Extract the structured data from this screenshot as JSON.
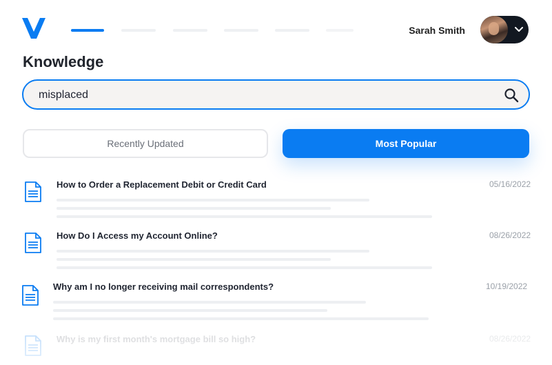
{
  "header": {
    "logo_label": "V",
    "user_name": "Sarah Smith",
    "avatar_icon": "user-avatar",
    "menu_icon": "chevron-down-icon",
    "nav_items": [
      {
        "label": "",
        "active": true
      },
      {
        "label": "",
        "active": false
      },
      {
        "label": "",
        "active": false
      },
      {
        "label": "",
        "active": false
      },
      {
        "label": "",
        "active": false
      },
      {
        "label": "",
        "active": false
      }
    ]
  },
  "page": {
    "title": "Knowledge"
  },
  "search": {
    "value": "misplaced",
    "placeholder": "",
    "icon": "search-icon"
  },
  "tabs": {
    "recent_label": "Recently Updated",
    "popular_label": "Most Popular",
    "selected": "Most Popular"
  },
  "articles": [
    {
      "title": "How to Order a Replacement Debit or Credit Card",
      "date": "05/16/2022",
      "icon": "document-icon"
    },
    {
      "title": "How Do I Access my Account Online?",
      "date": "08/26/2022",
      "icon": "document-icon"
    },
    {
      "title": "Why am I no longer receiving mail correspondents?",
      "date": "10/19/2022",
      "icon": "document-icon"
    },
    {
      "title": "Why is my first month's mortgage bill so high?",
      "date": "08/26/2022",
      "icon": "document-icon"
    }
  ],
  "colors": {
    "accent": "#0a7cf2",
    "text": "#1f2430",
    "muted": "#9aa0a8"
  }
}
